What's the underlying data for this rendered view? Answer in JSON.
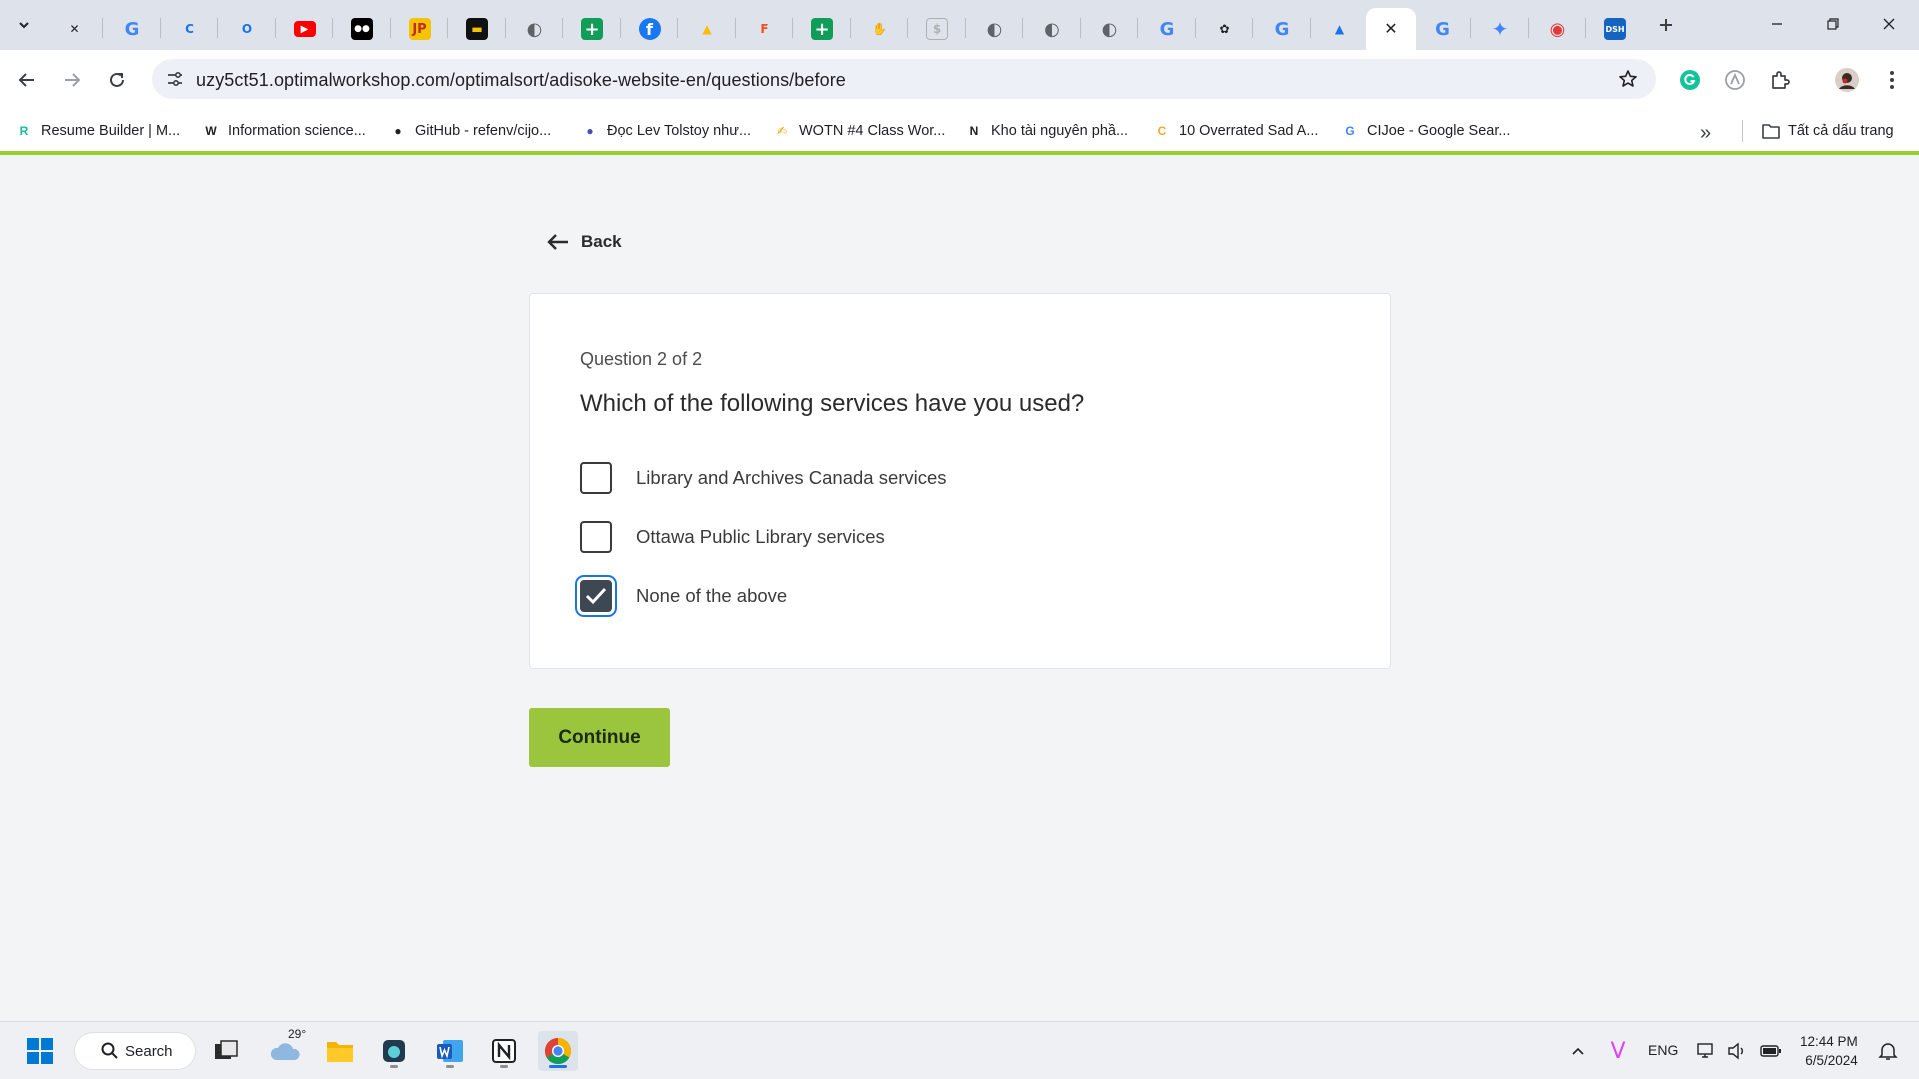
{
  "browser": {
    "url": "uzy5ct51.optimalworkshop.com/optimalsort/adisoke-website-en/questions/before",
    "tabs": [
      {
        "icon": "ubisoft-icon",
        "glyph": "✕",
        "color": "#202124"
      },
      {
        "icon": "google-icon",
        "glyph": "G",
        "color": "#4285f4"
      },
      {
        "icon": "c-logo-icon",
        "glyph": "C",
        "color": "#1a73e8"
      },
      {
        "icon": "opera-icon",
        "glyph": "O",
        "color": "#1a73e8"
      },
      {
        "icon": "youtube-icon",
        "glyph": "▶",
        "color": "#ff0000"
      },
      {
        "icon": "medium-icon",
        "glyph": "●●",
        "color": "#000000"
      },
      {
        "icon": "jp-icon",
        "glyph": "JP",
        "color": "#f5c400"
      },
      {
        "icon": "dark-app-icon",
        "glyph": "▬",
        "color": "#111111"
      },
      {
        "icon": "globe-icon",
        "glyph": "◐",
        "color": "#5f6368"
      },
      {
        "icon": "sheets-icon",
        "glyph": "+",
        "color": "#0f9d58"
      },
      {
        "icon": "facebook-icon",
        "glyph": "f",
        "color": "#1877f2"
      },
      {
        "icon": "drive-icon",
        "glyph": "▲",
        "color": "#fbbc04"
      },
      {
        "icon": "figma-icon",
        "glyph": "F",
        "color": "#f24e1e"
      },
      {
        "icon": "sheets-icon-2",
        "glyph": "+",
        "color": "#0f9d58"
      },
      {
        "icon": "hand-icon",
        "glyph": "✋",
        "color": "#e8a87c"
      },
      {
        "icon": "dollar-icon",
        "glyph": "$",
        "color": "#b0b0b0"
      },
      {
        "icon": "globe-icon-2",
        "glyph": "◐",
        "color": "#5f6368"
      },
      {
        "icon": "globe-icon-3",
        "glyph": "◐",
        "color": "#5f6368"
      },
      {
        "icon": "globe-icon-4",
        "glyph": "◐",
        "color": "#5f6368"
      },
      {
        "icon": "google-icon-2",
        "glyph": "G",
        "color": "#4285f4"
      },
      {
        "icon": "openai-icon",
        "glyph": "✿",
        "color": "#202124"
      },
      {
        "icon": "google-icon-3",
        "glyph": "G",
        "color": "#4285f4"
      },
      {
        "icon": "app-a-icon",
        "glyph": "▲",
        "color": "#1a73e8"
      }
    ],
    "active_tab": {
      "icon": "close-tab-icon",
      "glyph": "✕"
    },
    "tabs_after": [
      {
        "icon": "google-icon-4",
        "glyph": "G",
        "color": "#4285f4"
      },
      {
        "icon": "gemini-icon",
        "glyph": "✦",
        "color": "#4285f4"
      },
      {
        "icon": "gmail-badge-icon",
        "glyph": "◉",
        "color": "#e53935"
      },
      {
        "icon": "dsh-icon",
        "glyph": "DSH",
        "color": "#1565c0"
      }
    ],
    "bookmarks": [
      {
        "label": "Resume Builder | M...",
        "icon": "resume-builder-icon",
        "glyph": "R",
        "color": "#1abc9c"
      },
      {
        "label": "Information science...",
        "icon": "wikipedia-icon",
        "glyph": "W",
        "color": "#202124"
      },
      {
        "label": "GitHub - refenv/cijo...",
        "icon": "github-icon",
        "glyph": "●",
        "color": "#202124"
      },
      {
        "label": "Đọc Lev Tolstoy như...",
        "icon": "blog-icon",
        "glyph": "●",
        "color": "#3f51b5"
      },
      {
        "label": "WOTN #4 Class Wor...",
        "icon": "pen-icon",
        "glyph": "✍",
        "color": "#f0a500"
      },
      {
        "label": "Kho tài nguyên phầ...",
        "icon": "notion-icon",
        "glyph": "N",
        "color": "#202124"
      },
      {
        "label": "10 Overrated Sad A...",
        "icon": "c-yellow-icon",
        "glyph": "C",
        "color": "#f9a825"
      },
      {
        "label": "CIJoe - Google Sear...",
        "icon": "google-search-icon",
        "glyph": "G",
        "color": "#4285f4"
      }
    ],
    "all_bookmarks_label": "Tất cả dấu trang"
  },
  "page": {
    "back_label": "Back",
    "question_counter": "Question 2 of 2",
    "question_text": "Which of the following services have you used?",
    "options": [
      {
        "label": "Library and Archives Canada services",
        "checked": false
      },
      {
        "label": "Ottawa Public Library services",
        "checked": false
      },
      {
        "label": "None of the above",
        "checked": true
      }
    ],
    "continue_label": "Continue",
    "accent_color": "#9bc53d"
  },
  "taskbar": {
    "search_label": "Search",
    "weather_temp": "29°",
    "language": "ENG",
    "time": "12:44 PM",
    "date": "6/5/2024"
  }
}
